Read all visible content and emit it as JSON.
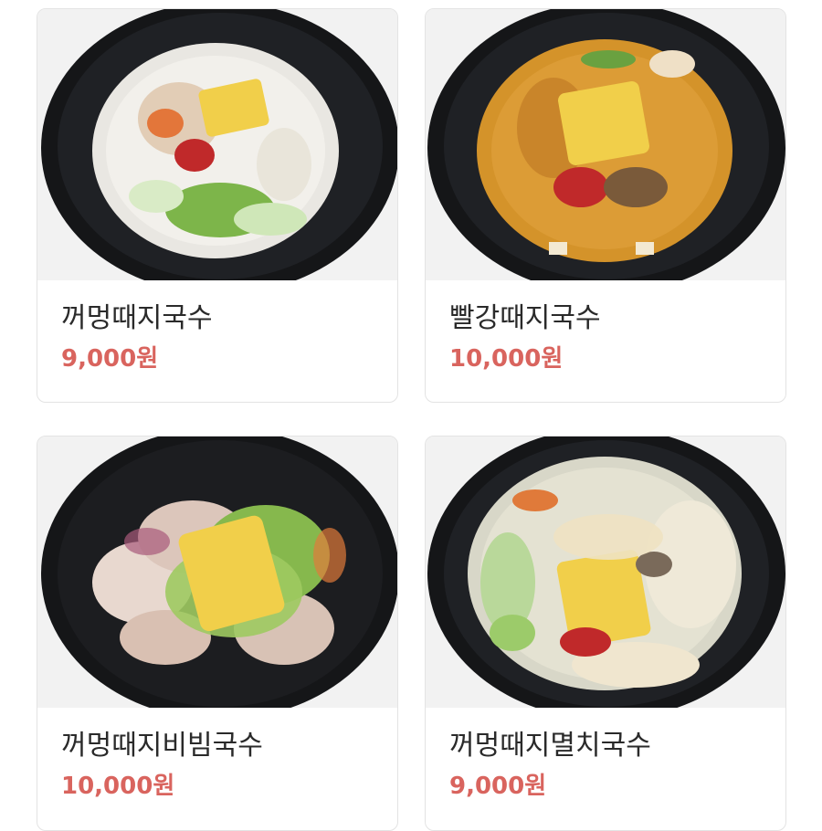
{
  "menu": {
    "items": [
      {
        "name": "꺼멍때지국수",
        "price": "9,000원",
        "photo_icon": "white-broth-noodle-bowl-icon"
      },
      {
        "name": "빨강때지국수",
        "price": "10,000원",
        "photo_icon": "spicy-red-broth-noodle-bowl-icon"
      },
      {
        "name": "꺼멍때지비빔국수",
        "price": "10,000원",
        "photo_icon": "bibim-noodle-bowl-icon"
      },
      {
        "name": "꺼멍때지멸치국수",
        "price": "9,000원",
        "photo_icon": "anchovy-broth-noodle-bowl-icon"
      }
    ]
  },
  "colors": {
    "price": "#d9645e",
    "name": "#2a2a2a",
    "card_border": "#e3e3e3",
    "bowl": "#151618"
  }
}
